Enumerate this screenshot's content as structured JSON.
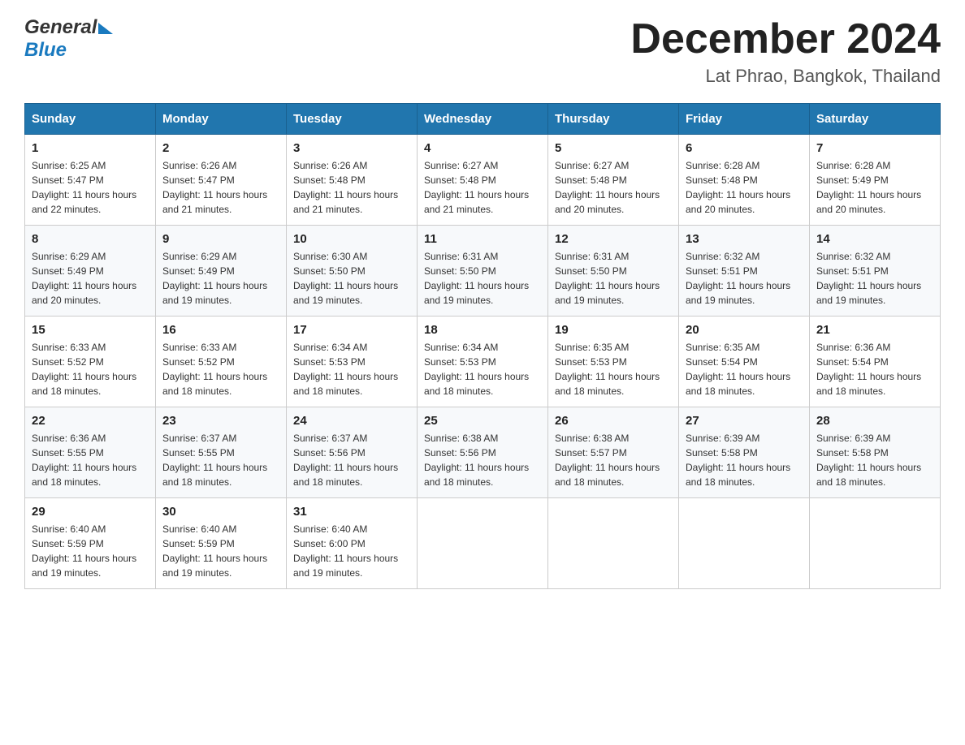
{
  "header": {
    "logo_general": "General",
    "logo_blue": "Blue",
    "month_title": "December 2024",
    "location": "Lat Phrao, Bangkok, Thailand"
  },
  "days_of_week": [
    "Sunday",
    "Monday",
    "Tuesday",
    "Wednesday",
    "Thursday",
    "Friday",
    "Saturday"
  ],
  "weeks": [
    [
      {
        "day": "1",
        "sunrise": "6:25 AM",
        "sunset": "5:47 PM",
        "daylight": "11 hours and 22 minutes."
      },
      {
        "day": "2",
        "sunrise": "6:26 AM",
        "sunset": "5:47 PM",
        "daylight": "11 hours and 21 minutes."
      },
      {
        "day": "3",
        "sunrise": "6:26 AM",
        "sunset": "5:48 PM",
        "daylight": "11 hours and 21 minutes."
      },
      {
        "day": "4",
        "sunrise": "6:27 AM",
        "sunset": "5:48 PM",
        "daylight": "11 hours and 21 minutes."
      },
      {
        "day": "5",
        "sunrise": "6:27 AM",
        "sunset": "5:48 PM",
        "daylight": "11 hours and 20 minutes."
      },
      {
        "day": "6",
        "sunrise": "6:28 AM",
        "sunset": "5:48 PM",
        "daylight": "11 hours and 20 minutes."
      },
      {
        "day": "7",
        "sunrise": "6:28 AM",
        "sunset": "5:49 PM",
        "daylight": "11 hours and 20 minutes."
      }
    ],
    [
      {
        "day": "8",
        "sunrise": "6:29 AM",
        "sunset": "5:49 PM",
        "daylight": "11 hours and 20 minutes."
      },
      {
        "day": "9",
        "sunrise": "6:29 AM",
        "sunset": "5:49 PM",
        "daylight": "11 hours and 19 minutes."
      },
      {
        "day": "10",
        "sunrise": "6:30 AM",
        "sunset": "5:50 PM",
        "daylight": "11 hours and 19 minutes."
      },
      {
        "day": "11",
        "sunrise": "6:31 AM",
        "sunset": "5:50 PM",
        "daylight": "11 hours and 19 minutes."
      },
      {
        "day": "12",
        "sunrise": "6:31 AM",
        "sunset": "5:50 PM",
        "daylight": "11 hours and 19 minutes."
      },
      {
        "day": "13",
        "sunrise": "6:32 AM",
        "sunset": "5:51 PM",
        "daylight": "11 hours and 19 minutes."
      },
      {
        "day": "14",
        "sunrise": "6:32 AM",
        "sunset": "5:51 PM",
        "daylight": "11 hours and 19 minutes."
      }
    ],
    [
      {
        "day": "15",
        "sunrise": "6:33 AM",
        "sunset": "5:52 PM",
        "daylight": "11 hours and 18 minutes."
      },
      {
        "day": "16",
        "sunrise": "6:33 AM",
        "sunset": "5:52 PM",
        "daylight": "11 hours and 18 minutes."
      },
      {
        "day": "17",
        "sunrise": "6:34 AM",
        "sunset": "5:53 PM",
        "daylight": "11 hours and 18 minutes."
      },
      {
        "day": "18",
        "sunrise": "6:34 AM",
        "sunset": "5:53 PM",
        "daylight": "11 hours and 18 minutes."
      },
      {
        "day": "19",
        "sunrise": "6:35 AM",
        "sunset": "5:53 PM",
        "daylight": "11 hours and 18 minutes."
      },
      {
        "day": "20",
        "sunrise": "6:35 AM",
        "sunset": "5:54 PM",
        "daylight": "11 hours and 18 minutes."
      },
      {
        "day": "21",
        "sunrise": "6:36 AM",
        "sunset": "5:54 PM",
        "daylight": "11 hours and 18 minutes."
      }
    ],
    [
      {
        "day": "22",
        "sunrise": "6:36 AM",
        "sunset": "5:55 PM",
        "daylight": "11 hours and 18 minutes."
      },
      {
        "day": "23",
        "sunrise": "6:37 AM",
        "sunset": "5:55 PM",
        "daylight": "11 hours and 18 minutes."
      },
      {
        "day": "24",
        "sunrise": "6:37 AM",
        "sunset": "5:56 PM",
        "daylight": "11 hours and 18 minutes."
      },
      {
        "day": "25",
        "sunrise": "6:38 AM",
        "sunset": "5:56 PM",
        "daylight": "11 hours and 18 minutes."
      },
      {
        "day": "26",
        "sunrise": "6:38 AM",
        "sunset": "5:57 PM",
        "daylight": "11 hours and 18 minutes."
      },
      {
        "day": "27",
        "sunrise": "6:39 AM",
        "sunset": "5:58 PM",
        "daylight": "11 hours and 18 minutes."
      },
      {
        "day": "28",
        "sunrise": "6:39 AM",
        "sunset": "5:58 PM",
        "daylight": "11 hours and 18 minutes."
      }
    ],
    [
      {
        "day": "29",
        "sunrise": "6:40 AM",
        "sunset": "5:59 PM",
        "daylight": "11 hours and 19 minutes."
      },
      {
        "day": "30",
        "sunrise": "6:40 AM",
        "sunset": "5:59 PM",
        "daylight": "11 hours and 19 minutes."
      },
      {
        "day": "31",
        "sunrise": "6:40 AM",
        "sunset": "6:00 PM",
        "daylight": "11 hours and 19 minutes."
      },
      null,
      null,
      null,
      null
    ]
  ],
  "labels": {
    "sunrise": "Sunrise:",
    "sunset": "Sunset:",
    "daylight": "Daylight:"
  }
}
